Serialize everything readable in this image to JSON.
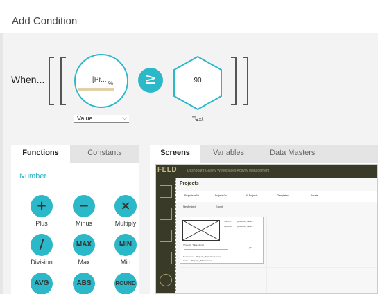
{
  "dialog": {
    "title": "Add Condition"
  },
  "condition": {
    "when_label": "When...",
    "value_expression": "[Pr...",
    "value_percent": "%",
    "value_select": "Value",
    "operator_symbol": "≥",
    "compare_value": "90",
    "compare_type_label": "Text"
  },
  "left_panel": {
    "tabs": [
      "Functions",
      "Constants"
    ],
    "active_tab": "Functions",
    "category": "Number",
    "functions": [
      {
        "label": "Plus",
        "symbol": "+"
      },
      {
        "label": "Minus",
        "symbol": "−"
      },
      {
        "label": "Multiply",
        "symbol": "×"
      },
      {
        "label": "Division",
        "symbol": "/"
      },
      {
        "label": "Max",
        "symbol": "MAX"
      },
      {
        "label": "Min",
        "symbol": "MIN"
      },
      {
        "label": "",
        "symbol": "AVG"
      },
      {
        "label": "",
        "symbol": "ABS"
      },
      {
        "label": "",
        "symbol": "ROUND"
      }
    ]
  },
  "right_panel": {
    "tabs": [
      "Screens",
      "Variables",
      "Data Masters"
    ],
    "active_tab": "Screens",
    "preview": {
      "logo": "FELD",
      "nav": "Dashboard   Gallery   Workspaces   Activity Management",
      "page_title": "Projects",
      "columns": [
        "ProjectsInOut",
        "ProjectsOut",
        "All Projects",
        "Templates",
        "Assets"
      ],
      "new_project": "NewProject",
      "export": "Export",
      "card_name": "[Projects_Table.Name]",
      "card_start_label": "StartOn",
      "card_start_value": "[Projects_Table....",
      "card_open_label": "OpenOn",
      "card_open_value": "[Projects_Table....",
      "card_pct": "[Pr...",
      "card_resp_label": "Responder",
      "card_resp_value": "[Projects_Table.Responder]",
      "card_owner_label": "Owner",
      "card_owner_value": "[Projects_Table.Owner]"
    }
  },
  "colors": {
    "accent": "#2bb8c8",
    "progress": "#e0d1a8",
    "preview_dark": "#3a3a28"
  }
}
